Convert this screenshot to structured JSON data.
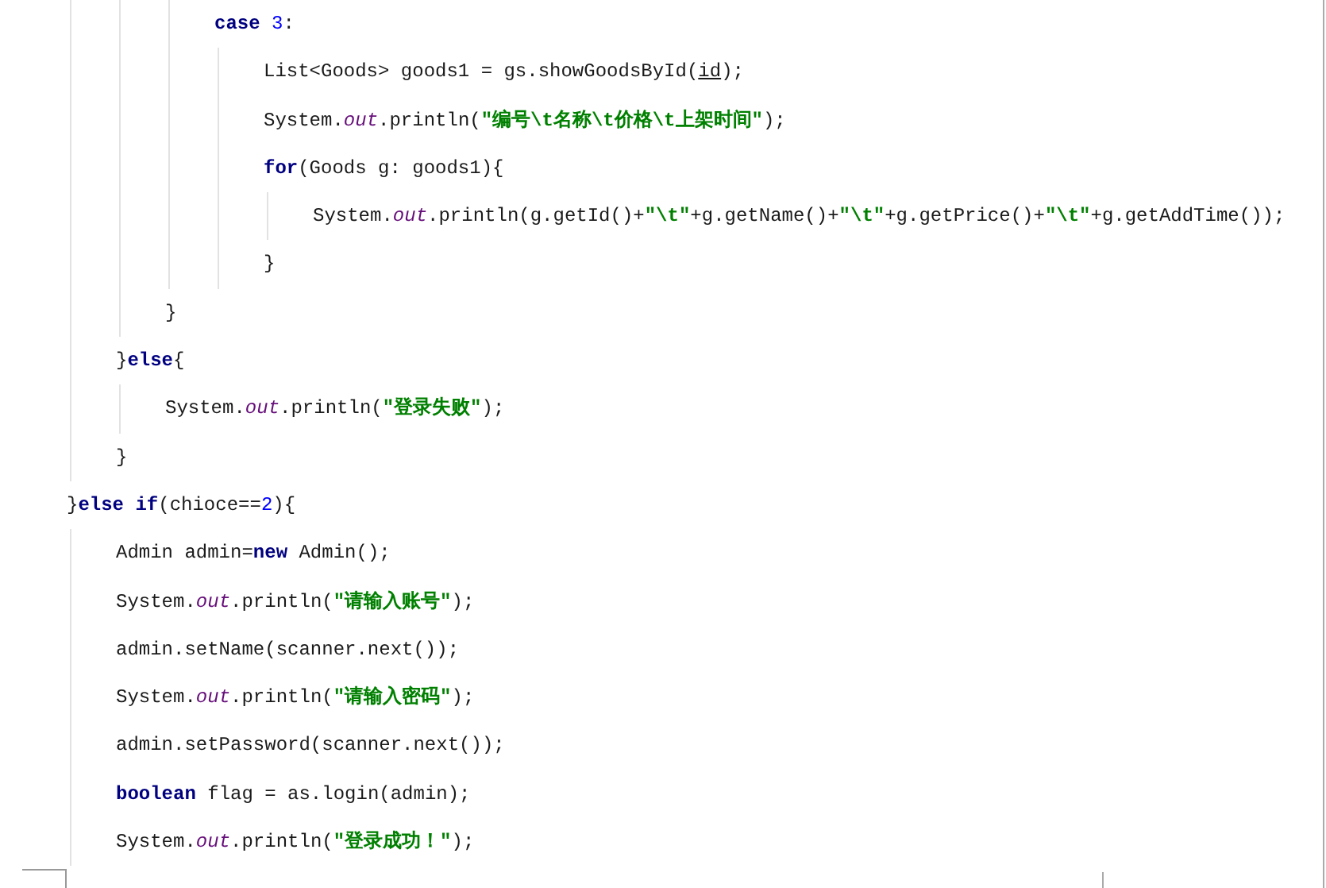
{
  "code_lines": [
    {
      "children": [
        {
          "children": [
            {
              "children": [
                {
                  "tokens": [
                    {
                      "kind": "keyword",
                      "text": "case "
                    },
                    {
                      "kind": "number",
                      "text": "3"
                    },
                    {
                      "kind": "plain",
                      "text": ":"
                    }
                  ],
                  "children": [
                    {
                      "tokens": [
                        {
                          "kind": "plain",
                          "text": "List<Goods> goods1 = gs.showGoodsById("
                        },
                        {
                          "kind": "param",
                          "text": "id"
                        },
                        {
                          "kind": "plain",
                          "text": ");"
                        }
                      ]
                    },
                    {
                      "tokens": [
                        {
                          "kind": "plain",
                          "text": "System."
                        },
                        {
                          "kind": "field",
                          "text": "out"
                        },
                        {
                          "kind": "plain",
                          "text": ".println("
                        },
                        {
                          "kind": "string",
                          "text": "\"编号\\t名称\\t价格\\t上架时间\""
                        },
                        {
                          "kind": "plain",
                          "text": ");"
                        }
                      ]
                    },
                    {
                      "tokens": [
                        {
                          "kind": "keyword",
                          "text": "for"
                        },
                        {
                          "kind": "plain",
                          "text": "(Goods g: goods1){"
                        }
                      ],
                      "children": [
                        {
                          "tokens": [
                            {
                              "kind": "plain",
                              "text": "System."
                            },
                            {
                              "kind": "field",
                              "text": "out"
                            },
                            {
                              "kind": "plain",
                              "text": ".println(g.getId()+"
                            },
                            {
                              "kind": "string",
                              "text": "\"\\t\""
                            },
                            {
                              "kind": "plain",
                              "text": "+g.getName()+"
                            },
                            {
                              "kind": "string",
                              "text": "\"\\t\""
                            },
                            {
                              "kind": "plain",
                              "text": "+g.getPrice()+"
                            },
                            {
                              "kind": "string",
                              "text": "\"\\t\""
                            },
                            {
                              "kind": "plain",
                              "text": "+g.getAddTime());"
                            }
                          ]
                        }
                      ]
                    },
                    {
                      "tokens": [
                        {
                          "kind": "plain",
                          "text": "}"
                        }
                      ]
                    }
                  ]
                }
              ]
            },
            {
              "tokens": [
                {
                  "kind": "plain",
                  "text": "}"
                }
              ]
            }
          ]
        },
        {
          "tokens": [
            {
              "kind": "plain",
              "text": "}"
            },
            {
              "kind": "keyword",
              "text": "else"
            },
            {
              "kind": "plain",
              "text": "{"
            }
          ],
          "children": [
            {
              "tokens": [
                {
                  "kind": "plain",
                  "text": "System."
                },
                {
                  "kind": "field",
                  "text": "out"
                },
                {
                  "kind": "plain",
                  "text": ".println("
                },
                {
                  "kind": "string",
                  "text": "\"登录失败\""
                },
                {
                  "kind": "plain",
                  "text": ");"
                }
              ]
            }
          ]
        },
        {
          "tokens": [
            {
              "kind": "plain",
              "text": "}"
            }
          ]
        }
      ]
    },
    {
      "tokens": [
        {
          "kind": "plain",
          "text": "}"
        },
        {
          "kind": "keyword",
          "text": "else if"
        },
        {
          "kind": "plain",
          "text": "(chioce=="
        },
        {
          "kind": "number",
          "text": "2"
        },
        {
          "kind": "plain",
          "text": "){"
        }
      ],
      "children": [
        {
          "tokens": [
            {
              "kind": "plain",
              "text": "Admin admin="
            },
            {
              "kind": "keyword",
              "text": "new"
            },
            {
              "kind": "plain",
              "text": " Admin();"
            }
          ]
        },
        {
          "tokens": [
            {
              "kind": "plain",
              "text": "System."
            },
            {
              "kind": "field",
              "text": "out"
            },
            {
              "kind": "plain",
              "text": ".println("
            },
            {
              "kind": "string",
              "text": "\"请输入账号\""
            },
            {
              "kind": "plain",
              "text": ");"
            }
          ]
        },
        {
          "tokens": [
            {
              "kind": "plain",
              "text": "admin.setName(scanner.next());"
            }
          ]
        },
        {
          "tokens": [
            {
              "kind": "plain",
              "text": "System."
            },
            {
              "kind": "field",
              "text": "out"
            },
            {
              "kind": "plain",
              "text": ".println("
            },
            {
              "kind": "string",
              "text": "\"请输入密码\""
            },
            {
              "kind": "plain",
              "text": ");"
            }
          ]
        },
        {
          "tokens": [
            {
              "kind": "plain",
              "text": "admin.setPassword(scanner.next());"
            }
          ]
        },
        {
          "tokens": [
            {
              "kind": "keyword",
              "text": "boolean"
            },
            {
              "kind": "plain",
              "text": " flag = as.login(admin);"
            }
          ]
        },
        {
          "tokens": [
            {
              "kind": "plain",
              "text": "System."
            },
            {
              "kind": "field",
              "text": "out"
            },
            {
              "kind": "plain",
              "text": ".println("
            },
            {
              "kind": "string",
              "text": "\"登录成功！\""
            },
            {
              "kind": "plain",
              "text": ");"
            }
          ]
        }
      ]
    }
  ]
}
